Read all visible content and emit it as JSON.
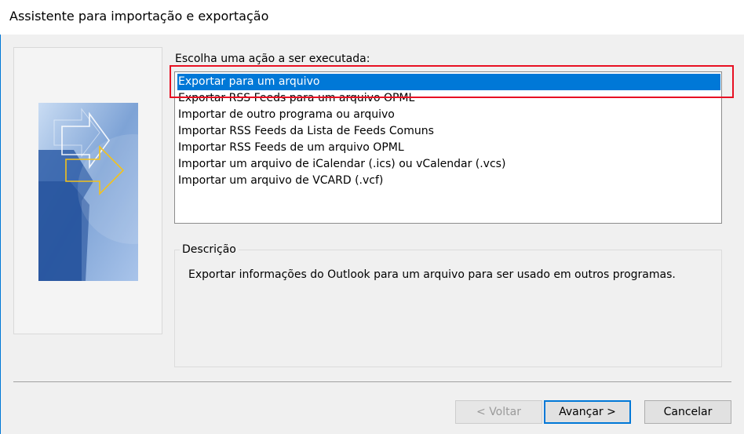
{
  "window": {
    "title": "Assistente para importação e exportação"
  },
  "actions": {
    "label": "Escolha uma ação a ser executada:",
    "selected_index": 0,
    "items": [
      "Exportar para um arquivo",
      "Exportar RSS Feeds para um arquivo OPML",
      "Importar de outro programa ou arquivo",
      "Importar RSS Feeds da Lista de Feeds Comuns",
      "Importar RSS Feeds de um arquivo OPML",
      "Importar um arquivo de iCalendar (.ics) ou vCalendar (.vcs)",
      "Importar um arquivo de VCARD (.vcf)"
    ]
  },
  "description": {
    "legend": "Descrição",
    "text": "Exportar informações do Outlook para um arquivo para ser usado em outros programas."
  },
  "buttons": {
    "back": "< Voltar",
    "next": "Avançar >",
    "cancel": "Cancelar"
  },
  "colors": {
    "selection": "#0078d7",
    "annotation": "#e81123"
  },
  "icons": {
    "wizard_art": "import-export-arrows-art"
  }
}
